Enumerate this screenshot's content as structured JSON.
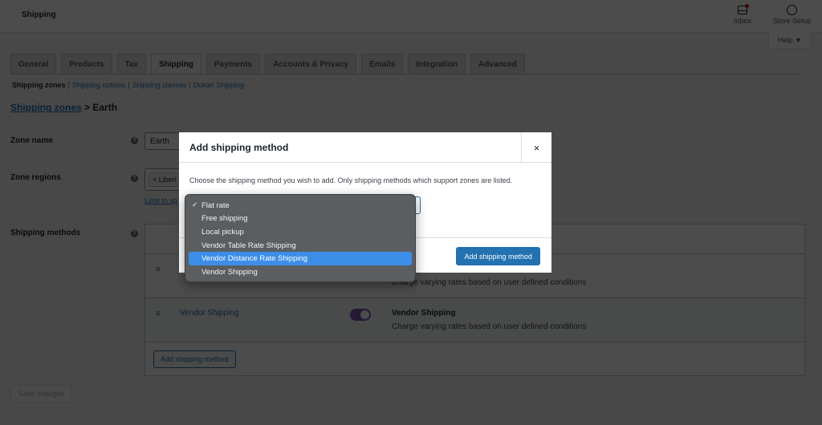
{
  "header": {
    "title": "Shipping",
    "activity": [
      {
        "label": "Inbox",
        "icon": "inbox-icon",
        "has_notification": true
      },
      {
        "label": "Store Setup",
        "icon": "store-setup-icon"
      }
    ],
    "help_label": "Help ▼"
  },
  "tabs": [
    {
      "label": "General",
      "active": false
    },
    {
      "label": "Products",
      "active": false
    },
    {
      "label": "Tax",
      "active": false
    },
    {
      "label": "Shipping",
      "active": true
    },
    {
      "label": "Payments",
      "active": false
    },
    {
      "label": "Accounts & Privacy",
      "active": false
    },
    {
      "label": "Emails",
      "active": false
    },
    {
      "label": "Integration",
      "active": false
    },
    {
      "label": "Advanced",
      "active": false
    }
  ],
  "subsections": {
    "current": "Shipping zones",
    "links": [
      "Shipping options",
      "Shipping classes",
      "Dokan Shipping"
    ],
    "separator": "|"
  },
  "breadcrumb": {
    "link": "Shipping zones",
    "separator": ">",
    "current": "Earth"
  },
  "form": {
    "zone_name_label": "Zone name",
    "zone_name_value": "Earth",
    "zone_regions_label": "Zone regions",
    "zone_region_chip": "× Liberi",
    "limit_link": "Limit to sp",
    "shipping_methods_label": "Shipping methods",
    "help_tip": "?"
  },
  "methods": [
    {
      "title": "",
      "enabled": true,
      "name": "",
      "description": "Charge varying rates based on user defined conditions"
    },
    {
      "title": "Vendor Shipping",
      "enabled": true,
      "name": "Vendor Shipping",
      "description": "Charge varying rates based on user defined conditions"
    }
  ],
  "table_add_button": "Add shipping method",
  "save_button": "Save changes",
  "modal": {
    "title": "Add shipping method",
    "close": "×",
    "description": "Choose the shipping method you wish to add. Only shipping methods which support zones are listed.",
    "add_button": "Add shipping method",
    "selected_value": "Flat rate"
  },
  "dropdown": {
    "checkmark": "✓",
    "options": [
      {
        "label": "Flat rate",
        "checked": true,
        "highlighted": false
      },
      {
        "label": "Free shipping",
        "checked": false,
        "highlighted": false
      },
      {
        "label": "Local pickup",
        "checked": false,
        "highlighted": false
      },
      {
        "label": "Vendor Table Rate Shipping",
        "checked": false,
        "highlighted": false
      },
      {
        "label": "Vendor Distance Rate Shipping",
        "checked": false,
        "highlighted": true
      },
      {
        "label": "Vendor Shipping",
        "checked": false,
        "highlighted": false
      }
    ]
  },
  "colors": {
    "accent": "#2271b1",
    "toggle_on": "#7f54b3",
    "dropdown_highlight": "#3d8ee8",
    "notification": "#cc1818"
  }
}
